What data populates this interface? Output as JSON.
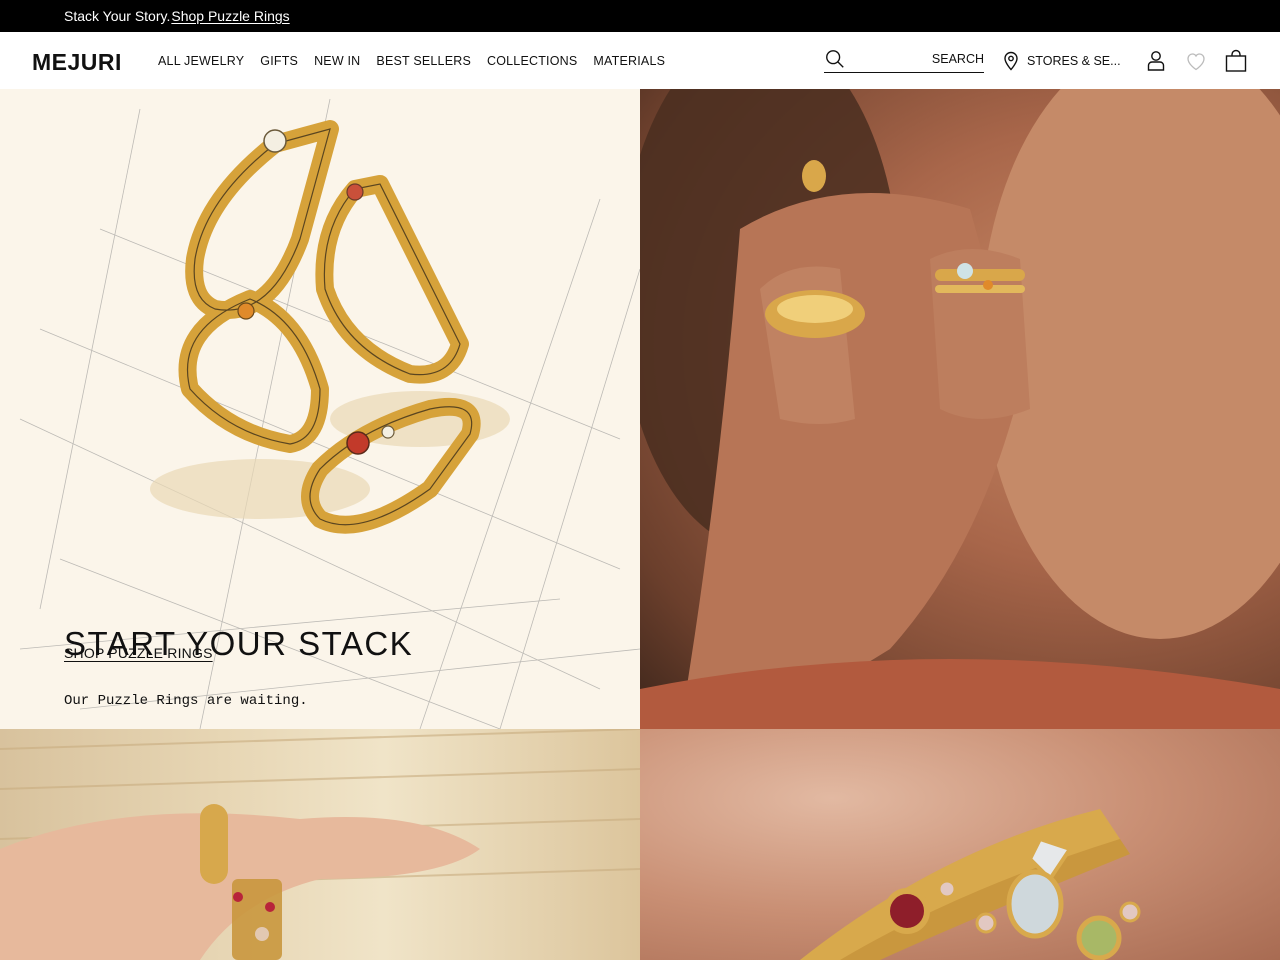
{
  "announcement": {
    "text": "Stack Your Story.",
    "link": "Shop Puzzle Rings"
  },
  "header": {
    "logo": "MEJURI",
    "nav": [
      "ALL JEWELRY",
      "GIFTS",
      "NEW IN",
      "BEST SELLERS",
      "COLLECTIONS",
      "MATERIALS"
    ],
    "search_placeholder": "SEARCH",
    "stores_label": "STORES & SE...",
    "icons": [
      "search-icon",
      "location-pin-icon",
      "account-icon",
      "heart-icon",
      "bag-icon"
    ]
  },
  "hero": {
    "title": "START YOUR STACK",
    "subtitle": "Our Puzzle Rings are waiting.",
    "cta": "SHOP PUZZLE RINGS"
  },
  "colors": {
    "announcement_bg": "#000000",
    "sketch_bg": "#fbf5ea",
    "gold": "#d6a23a"
  }
}
